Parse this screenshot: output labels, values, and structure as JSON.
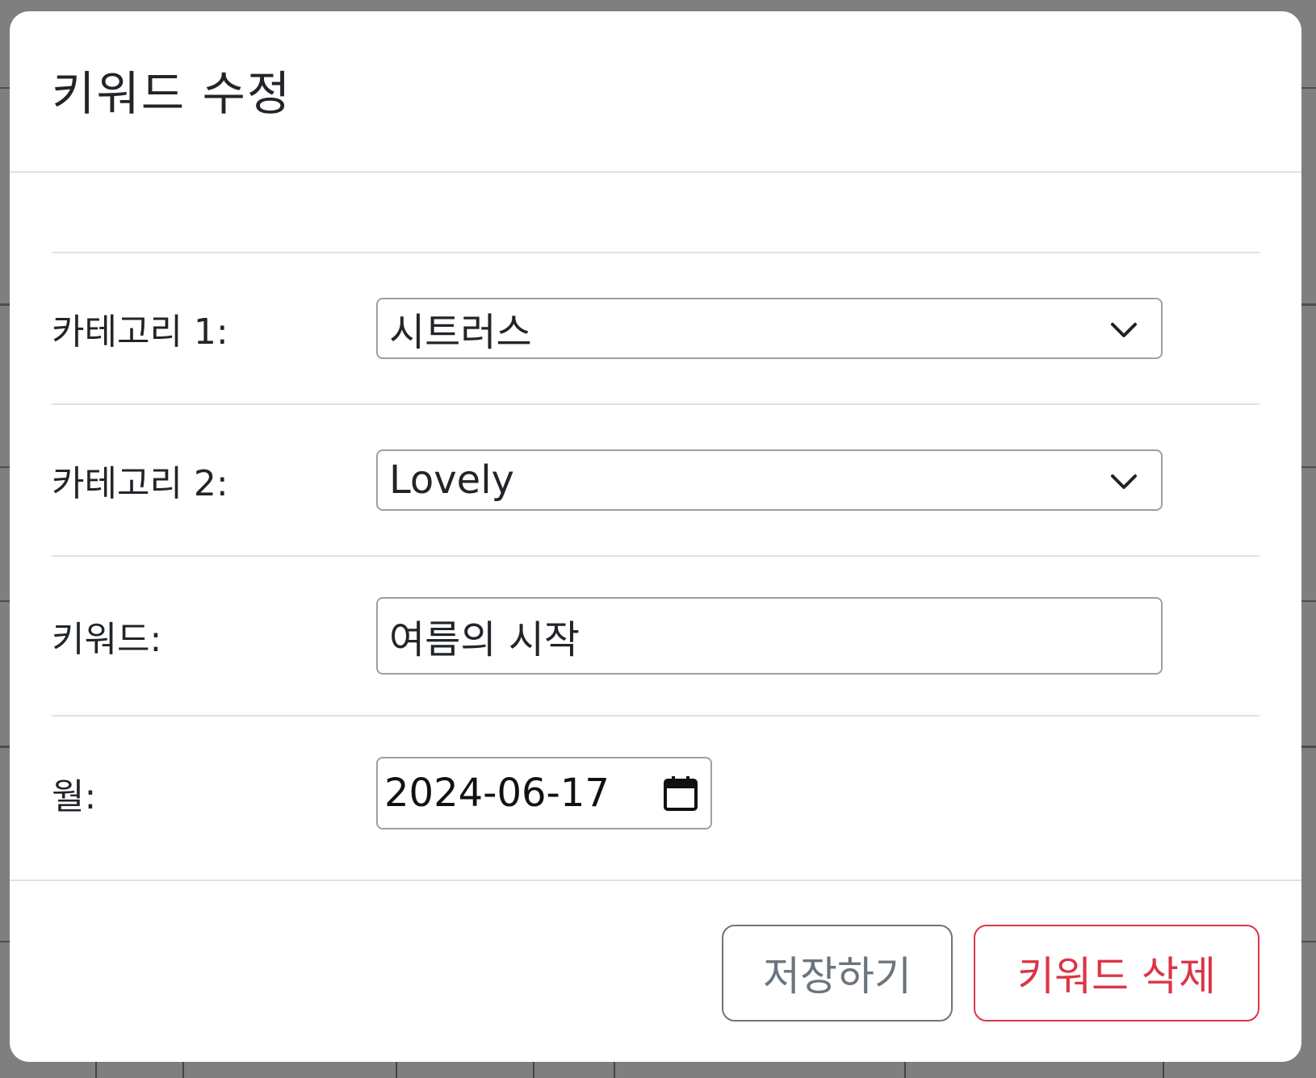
{
  "modal": {
    "title": "키워드 수정",
    "fields": {
      "category1": {
        "label": "카테고리 1:",
        "selected": "시트러스"
      },
      "category2": {
        "label": "카테고리 2:",
        "selected": "Lovely"
      },
      "keyword": {
        "label": "키워드:",
        "value": "여름의 시작"
      },
      "month": {
        "label": "월:",
        "value": "2024-06-17"
      }
    },
    "buttons": {
      "save": "저장하기",
      "delete": "키워드 삭제"
    }
  },
  "colors": {
    "save_outline": "#6c757d",
    "delete_outline": "#dc3545",
    "divider": "#dee2e6"
  }
}
